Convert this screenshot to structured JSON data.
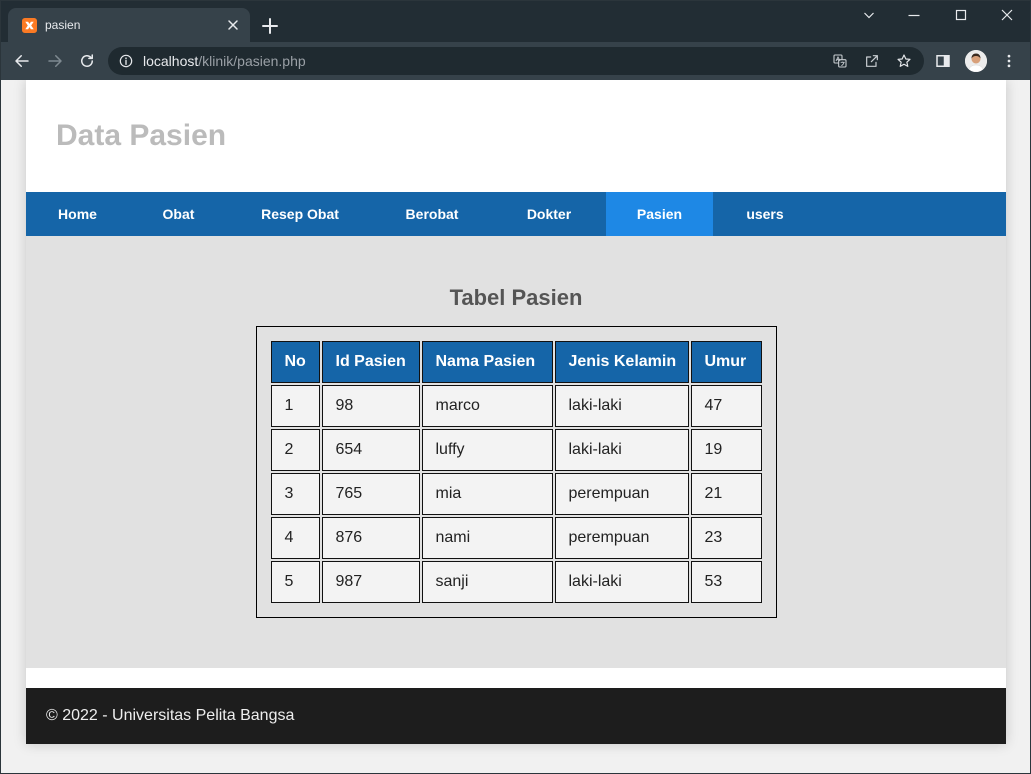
{
  "browser": {
    "tab": {
      "title": "pasien",
      "favicon": "xampp-icon",
      "close_icon": "close-icon"
    },
    "new_tab_icon": "plus-icon",
    "window_controls": [
      "chevron-down-icon",
      "minimize-icon",
      "maximize-icon",
      "close-icon"
    ],
    "address": {
      "host": "localhost",
      "path": "/klinik/pasien.php"
    },
    "toolbar_icons": [
      "back-arrow-icon",
      "forward-arrow-icon",
      "reload-icon",
      "info-icon",
      "translate-icon",
      "share-icon",
      "star-icon",
      "side-panel-icon",
      "avatar",
      "kebab-menu-icon"
    ]
  },
  "page": {
    "header_title": "Data Pasien",
    "nav": [
      {
        "label": "Home"
      },
      {
        "label": "Obat"
      },
      {
        "label": "Resep Obat"
      },
      {
        "label": "Berobat"
      },
      {
        "label": "Dokter"
      },
      {
        "label": "Pasien",
        "active": true
      },
      {
        "label": "users"
      }
    ],
    "table_title": "Tabel Pasien",
    "table": {
      "columns": [
        "No",
        "Id Pasien",
        "Nama Pasien",
        "Jenis Kelamin",
        "Umur"
      ],
      "rows": [
        [
          "1",
          "98",
          "marco",
          "laki-laki",
          "47"
        ],
        [
          "2",
          "654",
          "luffy",
          "laki-laki",
          "19"
        ],
        [
          "3",
          "765",
          "mia",
          "perempuan",
          "21"
        ],
        [
          "4",
          "876",
          "nami",
          "perempuan",
          "23"
        ],
        [
          "5",
          "987",
          "sanji",
          "laki-laki",
          "53"
        ]
      ]
    },
    "footer_text": "© 2022 - Universitas Pelita Bangsa"
  },
  "colors": {
    "frame": "#222d34",
    "toolbar": "#36424a",
    "omnibox": "#1f2a30",
    "nav": "#1565a8",
    "nav_active": "#1e88e5",
    "main_bg": "#e1e1e1",
    "footer_bg": "#1d1d1d",
    "header_title": "#bbbbbb"
  }
}
